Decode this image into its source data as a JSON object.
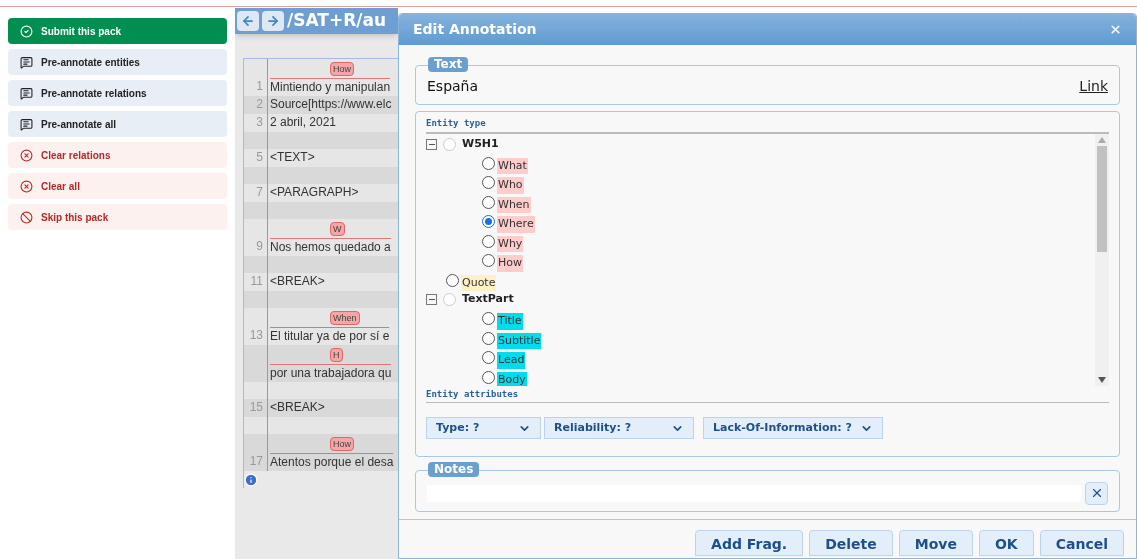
{
  "sidebar": {
    "buttons": [
      {
        "label": "Submit this pack",
        "kind": "submit"
      },
      {
        "label": "Pre-annotate entities",
        "kind": "preannotate"
      },
      {
        "label": "Pre-annotate relations",
        "kind": "preannotate"
      },
      {
        "label": "Pre-annotate all",
        "kind": "preannotate"
      },
      {
        "label": "Clear relations",
        "kind": "clear"
      },
      {
        "label": "Clear all",
        "kind": "clear"
      },
      {
        "label": "Skip this pack",
        "kind": "skip"
      }
    ]
  },
  "document": {
    "path": "/SAT+R/au",
    "rows": [
      {
        "kind": "text",
        "number": "1",
        "text": "Mintiendo y manipulan",
        "tag": "How"
      },
      {
        "kind": "text",
        "number": "2",
        "text": "Source[https://www.elc"
      },
      {
        "kind": "text",
        "number": "3",
        "text": "2 abril, 2021"
      },
      {
        "kind": "blank"
      },
      {
        "kind": "text",
        "number": "5",
        "text": "<TEXT>"
      },
      {
        "kind": "blank"
      },
      {
        "kind": "text",
        "number": "7",
        "text": "<PARAGRAPH>"
      },
      {
        "kind": "blank"
      },
      {
        "kind": "text",
        "number": "9",
        "text": "Nos hemos quedado a",
        "tag": "W"
      },
      {
        "kind": "blank"
      },
      {
        "kind": "text",
        "number": "11",
        "text": "<BREAK>"
      },
      {
        "kind": "blank"
      },
      {
        "kind": "text",
        "number": "13",
        "text": "El titular ya de por sí e",
        "tag": "When"
      },
      {
        "kind": "text",
        "text": "por una trabajadora qu",
        "tag": "H"
      },
      {
        "kind": "blank"
      },
      {
        "kind": "text",
        "number": "15",
        "text": "<BREAK>"
      },
      {
        "kind": "blank"
      },
      {
        "kind": "text",
        "number": "17",
        "text": "Atentos porque el desa",
        "tag": "How"
      }
    ]
  },
  "dialog": {
    "title": "Edit Annotation",
    "text_section": {
      "legend": "Text",
      "value": "España",
      "link": "Link"
    },
    "entity_type": {
      "heading": "Entity type",
      "tree": [
        {
          "kind": "group",
          "label": "W5H1",
          "expanded": true,
          "selected": false,
          "children": [
            {
              "kind": "item",
              "label": "What",
              "color": "#ffcccc",
              "selected": false
            },
            {
              "kind": "item",
              "label": "Who",
              "color": "#ffcccc",
              "selected": false
            },
            {
              "kind": "item",
              "label": "When",
              "color": "#ffcccc",
              "selected": false
            },
            {
              "kind": "item",
              "label": "Where",
              "color": "#ffcccc",
              "selected": true
            },
            {
              "kind": "item",
              "label": "Why",
              "color": "#ffcccc",
              "selected": false
            },
            {
              "kind": "item",
              "label": "How",
              "color": "#ffcccc",
              "selected": false
            }
          ]
        },
        {
          "kind": "item",
          "label": "Quote",
          "color": "#fff0c8",
          "selected": false
        },
        {
          "kind": "group",
          "label": "TextPart",
          "expanded": true,
          "selected": false,
          "children": [
            {
              "kind": "item",
              "label": "Title",
              "color": "#00dcec",
              "selected": false
            },
            {
              "kind": "item",
              "label": "Subtitle",
              "color": "#00dcec",
              "selected": false
            },
            {
              "kind": "item",
              "label": "Lead",
              "color": "#00dcec",
              "selected": false
            },
            {
              "kind": "item",
              "label": "Body",
              "color": "#00dcec",
              "selected": false
            }
          ]
        }
      ]
    },
    "entity_attributes": {
      "heading": "Entity attributes",
      "selects": [
        "Type: ?",
        "Reliability: ?",
        "Lack-Of-Information: ?"
      ]
    },
    "notes": {
      "legend": "Notes"
    },
    "buttons": [
      "Add Frag.",
      "Delete",
      "Move",
      "OK",
      "Cancel"
    ]
  }
}
